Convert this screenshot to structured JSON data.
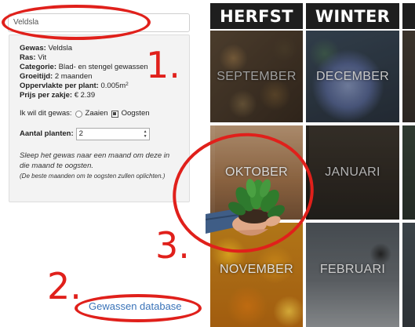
{
  "search": {
    "value": "Veldsla"
  },
  "crop": {
    "gewas_label": "Gewas:",
    "gewas_value": "Veldsla",
    "ras_label": "Ras:",
    "ras_value": "Vit",
    "categorie_label": "Categorie:",
    "categorie_value": "Blad- en stengel gewassen",
    "groeitijd_label": "Groeitijd:",
    "groeitijd_value": "2 maanden",
    "oppervlakte_label": "Oppervlakte per plant:",
    "oppervlakte_value": "0.005m",
    "oppervlakte_unit_sup": "2",
    "prijs_label": "Prijs per zakje:",
    "prijs_value": "€ 2.39"
  },
  "options": {
    "want_label": "Ik wil dit gewas:",
    "zaaien_label": "Zaaien",
    "oogsten_label": "Oogsten",
    "oogsten_checked": true
  },
  "amount": {
    "label": "Aantal planten:",
    "value": "2"
  },
  "hint": {
    "main": "Sleep het gewas naar een maand om deze in die maand te oogsten.",
    "small": "(De beste maanden om te oogsten zullen oplichten.)"
  },
  "database_link": "Gewassen database",
  "annotations": {
    "one": "1.",
    "two": "2.",
    "three": "3.",
    "color": "#e0201b"
  },
  "seasons": [
    {
      "name": "HERFST",
      "months": [
        "SEPTEMBER",
        "OKTOBER",
        "NOVEMBER"
      ]
    },
    {
      "name": "WINTER",
      "months": [
        "DECEMBER",
        "JANUARI",
        "FEBRUARI"
      ]
    }
  ],
  "colors": {
    "link": "#3a73b8",
    "header_bg": "#1e1e1e"
  }
}
